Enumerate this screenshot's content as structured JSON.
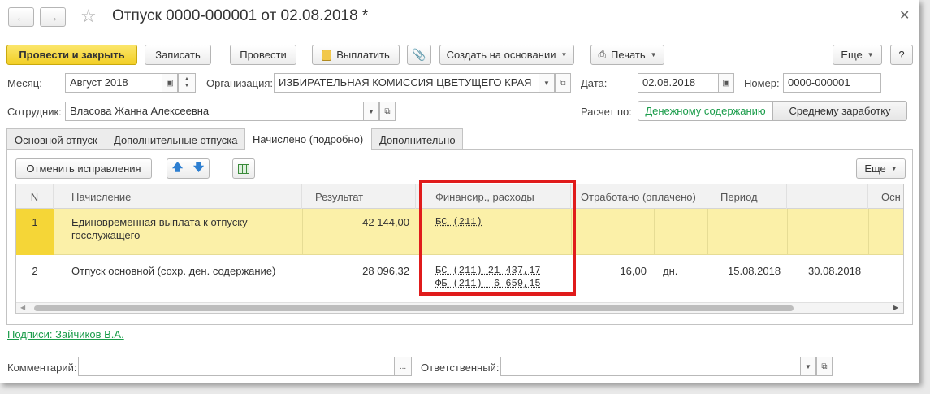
{
  "header": {
    "title": "Отпуск 0000-000001 от 02.08.2018 *"
  },
  "toolbar": {
    "post_close": "Провести и закрыть",
    "save": "Записать",
    "post": "Провести",
    "pay": "Выплатить",
    "create_based": "Создать на основании",
    "print": "Печать",
    "more": "Еще",
    "help": "?"
  },
  "form": {
    "month_label": "Месяц:",
    "month_value": "Август 2018",
    "org_label": "Организация:",
    "org_value": "ИЗБИРАТЕЛЬНАЯ КОМИССИЯ ЦВЕТУЩЕГО КРАЯ",
    "date_label": "Дата:",
    "date_value": "02.08.2018",
    "number_label": "Номер:",
    "number_value": "0000-000001",
    "employee_label": "Сотрудник:",
    "employee_value": "Власова Жанна Алексеевна",
    "calc_label": "Расчет по:",
    "calc_option1": "Денежному содержанию",
    "calc_option2": "Среднему заработку"
  },
  "tabs": [
    "Основной отпуск",
    "Дополнительные отпуска",
    "Начислено (подробно)",
    "Дополнительно"
  ],
  "table_toolbar": {
    "cancel_corrections": "Отменить исправления",
    "more": "Еще"
  },
  "table": {
    "columns": [
      "N",
      "Начисление",
      "Результат",
      "Финансир., расходы",
      "Отработано (оплачено)",
      "Период",
      "",
      "Осн"
    ],
    "rows": [
      {
        "n": "1",
        "accrual_line1": "Единовременная выплата к отпуску",
        "accrual_line2": "госслужащего",
        "result": "42 144,00",
        "fin_line1": "БС (211)",
        "fin_line2": "",
        "worked": "",
        "unit": "",
        "period_from": "",
        "period_to": ""
      },
      {
        "n": "2",
        "accrual_line1": "Отпуск основной (сохр. ден. содержание)",
        "accrual_line2": "",
        "result": "28 096,32",
        "fin_line1": "БС (211) 21 437,17",
        "fin_line2": "ФБ (211)  6 659,15",
        "worked": "16,00",
        "unit": "дн.",
        "period_from": "15.08.2018",
        "period_to": "30.08.2018"
      }
    ]
  },
  "footer": {
    "signatures": "Подписи: Зайчиков В.А.",
    "comment_label": "Комментарий:",
    "comment_value": "",
    "responsible_label": "Ответственный:",
    "responsible_value": ""
  },
  "colors": {
    "primary_button": "#f2cf26",
    "selected_row": "#fbf0a8",
    "highlight_border": "#e01b1b",
    "link_green": "#1a9c4a"
  }
}
